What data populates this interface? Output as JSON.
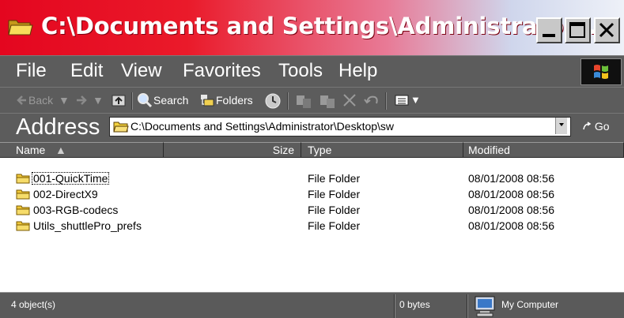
{
  "window": {
    "title": "C:\\Documents and Settings\\Administrator..."
  },
  "menu": [
    "File",
    "Edit",
    "View",
    "Favorites",
    "Tools",
    "Help"
  ],
  "toolbar": {
    "back": "Back",
    "search": "Search",
    "folders": "Folders"
  },
  "address": {
    "label": "Address",
    "path": "C:\\Documents and Settings\\Administrator\\Desktop\\sw",
    "go": "Go"
  },
  "columns": {
    "name": "Name",
    "size": "Size",
    "type": "Type",
    "modified": "Modified"
  },
  "files": [
    {
      "name": "001-QuickTime",
      "size": "",
      "type": "File Folder",
      "modified": "08/01/2008 08:56"
    },
    {
      "name": "002-DirectX9",
      "size": "",
      "type": "File Folder",
      "modified": "08/01/2008 08:56"
    },
    {
      "name": "003-RGB-codecs",
      "size": "",
      "type": "File Folder",
      "modified": "08/01/2008 08:56"
    },
    {
      "name": "Utils_shuttlePro_prefs",
      "size": "",
      "type": "File Folder",
      "modified": "08/01/2008 08:56"
    }
  ],
  "status": {
    "objects": "4 object(s)",
    "bytes": "0 bytes",
    "zone": "My Computer"
  },
  "icons": {
    "title": "folder-open-icon",
    "file": "folder-icon",
    "status": "my-computer-icon"
  },
  "colors": {
    "title_start": "#e4061f",
    "title_end": "#eef1f8",
    "chrome": "#5c5c5c",
    "folder": "#f4d23e"
  }
}
